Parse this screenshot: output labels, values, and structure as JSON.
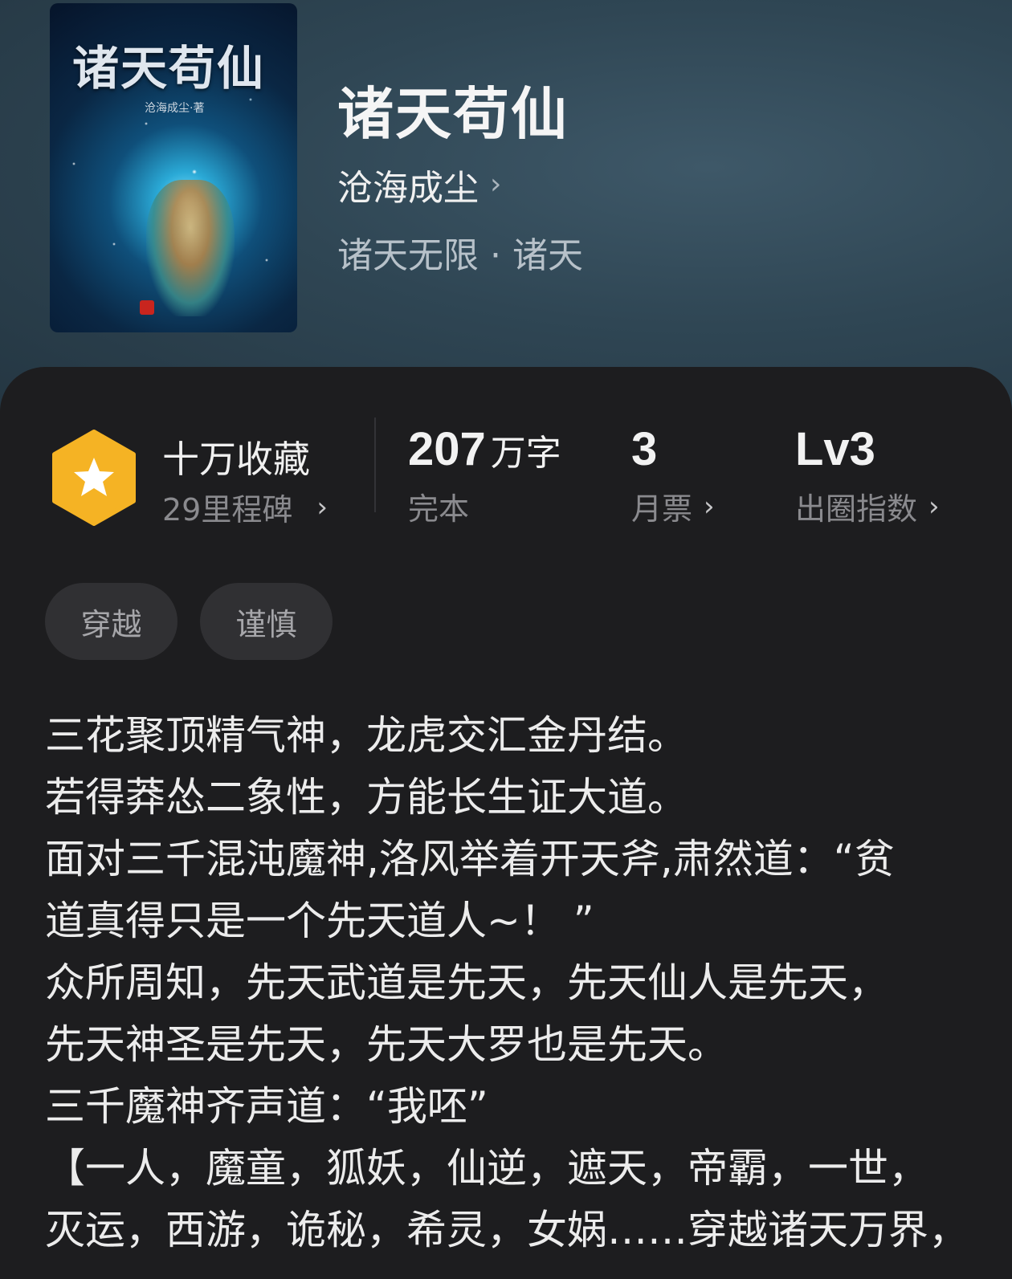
{
  "book": {
    "cover_title": "诸天苟仙",
    "cover_author": "沧海成尘·著",
    "title": "诸天苟仙",
    "author": "沧海成尘",
    "genre": "诸天无限",
    "subgenre": "诸天",
    "genre_separator": "·"
  },
  "stats": {
    "collect_label": "十万收藏",
    "milestone_label": "29里程碑",
    "word_count": "207",
    "word_unit": "万字",
    "status": "完本",
    "monthly_votes": "3",
    "monthly_votes_label": "月票",
    "level": "Lv3",
    "level_label": "出圈指数"
  },
  "tags": [
    "穿越",
    "谨慎"
  ],
  "synopsis": [
    "三花聚顶精气神，龙虎交汇金丹结。",
    "若得莽怂二象性，方能长生证大道。",
    "面对三千混沌魔神,洛风举着开天斧,肃然道：“贫",
    "道真得只是一个先天道人~！ ”",
    "众所周知，先天武道是先天，先天仙人是先天，",
    "先天神圣是先天，先天大罗也是先天。",
    "三千魔神齐声道：“我呸”",
    "【一人，魔童，狐妖，仙逆，遮天，帝霸，一世，",
    "灭运，西游，诡秘，希灵，女娲……穿越诸天万界，"
  ],
  "icons": {
    "badge": "star-hexagon-icon",
    "chevron": "chevron-right-icon"
  },
  "colors": {
    "badge_fill": "#f5b324",
    "sheet_bg": "#1d1d1f",
    "hero_bg": "#2f4654"
  }
}
